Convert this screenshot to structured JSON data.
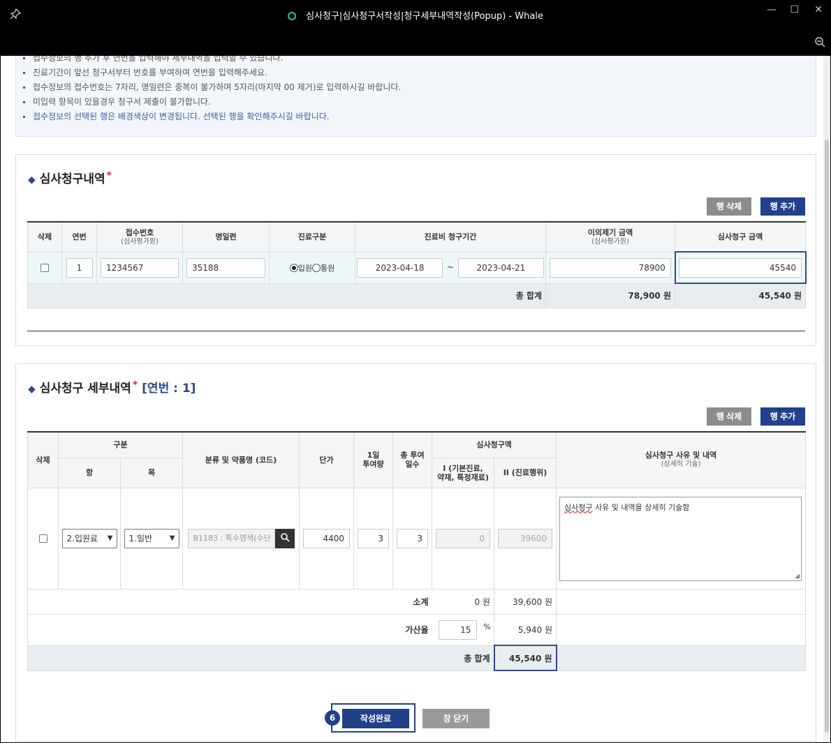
{
  "window": {
    "title": "심사청구|심사청구서작성|청구세부내역작성(Popup) - Whale",
    "pin_icon": "pin-icon",
    "minimize": "—",
    "maximize": "☐",
    "close": "✕",
    "zoom_icon": "zoom-out-icon"
  },
  "notice": {
    "items": [
      "접수정보의 행 추가 후 연번을 입력해야 세부내역을 입력할 수 있습니다.",
      "진료기간이 앞선 청구서부터 번호를 부여하여 연번을 입력해주세요.",
      "접수정보의 접수번호는 7자리, 명일련은 중복이 불가하며 5자리(마지막 00 제거)로 입력하시길 바랍니다.",
      "미입력 항목이 있을경우 청구서 제출이 불가합니다.",
      "접수정보의 선택된 행은 배경색상이 변경됩니다. 선택된 행을 확인해주시길 바랍니다."
    ]
  },
  "section1": {
    "title": "심사청구내역",
    "required_mark": "*",
    "delete_row": "행 삭제",
    "add_row": "행 추가",
    "headers": {
      "delete": "삭제",
      "seq": "연번",
      "receipt_no": "접수번호",
      "receipt_no_sub": "(심사평가원)",
      "serial": "명일련",
      "care_type": "진료구분",
      "period": "진료비 청구기간",
      "disputed_amount": "이의제기 금액",
      "disputed_amount_sub": "(심사평가원)",
      "claim_amount": "심사청구 금액"
    },
    "row": {
      "seq": "1",
      "receipt_no": "1234567",
      "serial": "35188",
      "inpatient": "입원",
      "outpatient": "통원",
      "period_from": "2023-04-18",
      "period_sep": "~",
      "period_to": "2023-04-21",
      "disputed_amount": "78900",
      "claim_amount": "45540"
    },
    "total_label": "총 합계",
    "total_disputed": "78,900 원",
    "total_claim": "45,540 원"
  },
  "section2": {
    "title": "심사청구 세부내역",
    "required_mark": "*",
    "seq_label": "[연번 : 1]",
    "delete_row": "행 삭제",
    "add_row": "행 추가",
    "headers": {
      "delete": "삭제",
      "category": "구분",
      "item": "항",
      "sub_item": "목",
      "drug": "분류 및 약품명 (코드)",
      "unit_price": "단가",
      "daily_dose_1": "1일",
      "daily_dose_2": "투여량",
      "total_days_1": "총 투여",
      "total_days_2": "일수",
      "claim_amount": "심사청구액",
      "col1_1": "I (기본진료,",
      "col1_2": "약재, 특정재료)",
      "col2": "II (진료행위)",
      "reason": "심사청구 사유 및 내역",
      "reason_sub": "(상세히 기술)"
    },
    "row": {
      "item": "2.입원료",
      "sub_item": "1.일반",
      "drug": "B1183 : 특수염색(수단",
      "unit_price": "4400",
      "daily_dose": "3",
      "total_days": "3",
      "amount1": "0",
      "amount2": "39600",
      "reason_word": "심사청구",
      "reason_rest": " 사유 및 내역을 상세히 기술함"
    },
    "subtotal_label": "소계",
    "subtotal1": "0 원",
    "subtotal2": "39,600 원",
    "rate_label": "가산율",
    "rate_value": "15",
    "rate_unit": "%",
    "rate_amount": "5,940 원",
    "total_label": "총 합계",
    "total_amount": "45,540 원"
  },
  "footer": {
    "step": "6",
    "submit": "작성완료",
    "close": "창 닫기"
  }
}
